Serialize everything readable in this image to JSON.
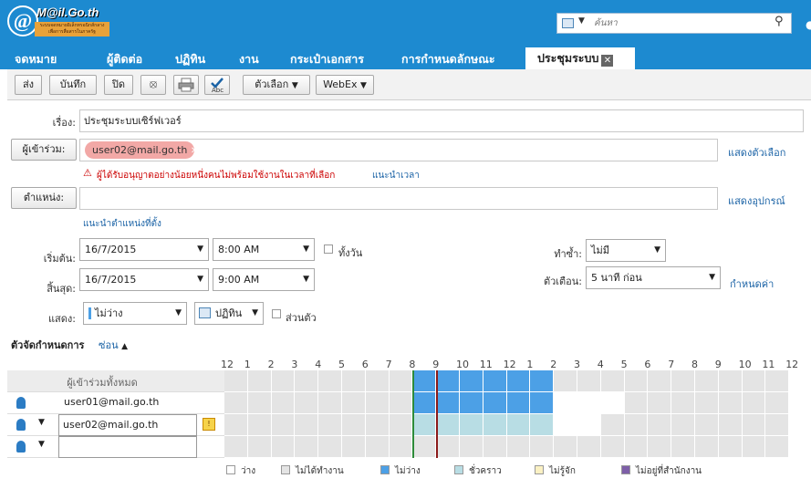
{
  "app": {
    "logo_name": "M@il.Go.th",
    "logo_tagline": "ระบบจดหมายอิเล็กทรอนิกส์กลาง เพื่อการสื่อสารในภาครัฐ",
    "logo_symbol": "@"
  },
  "search": {
    "placeholder": "ค้นหา"
  },
  "colors": {
    "brand": "#1d8ad0",
    "busy": "#4ca0e6",
    "tentative": "#b8dde4",
    "free": "#ffffff",
    "offhours": "#e4e4e4",
    "unknown": "#fbf1c3",
    "away": "#7e5fa8",
    "start_marker": "#2e8b3a",
    "end_marker": "#8b1a1a",
    "error_chip": "#f2a8a6"
  },
  "nav": {
    "items": [
      "จดหมาย",
      "ผู้ติดต่อ",
      "ปฏิทิน",
      "งาน",
      "กระเป๋าเอกสาร",
      "การกำหนดลักษณะ"
    ],
    "active": "ประชุมระบบ",
    "close_icon": "close-icon"
  },
  "toolbar": {
    "send": "ส่ง",
    "save": "บันทึก",
    "close": "ปิด",
    "options": "ตัวเลือก",
    "webex": "WebEx"
  },
  "form": {
    "subject_label": "เรื่อง:",
    "subject_value": "ประชุมระบบเซิร์ฟเวอร์",
    "attendees_label": "ผู้เข้าร่วม:",
    "attendee_chip": "user02@mail.go.th",
    "show_options": "แสดงตัวเลือก",
    "warning_text": "ผู้ได้รับอนุญาตอย่างน้อยหนึ่งคนไม่พร้อมใช้งานในเวลาที่เลือก",
    "suggest_time": "แนะนำเวลา",
    "location_label": "ตำแหน่ง:",
    "show_equipment": "แสดงอุปกรณ์",
    "suggest_location": "แนะนำตำแหน่งที่ตั้ง",
    "start_label": "เริ่มต้น:",
    "start_date": "16/7/2015",
    "start_time": "8:00 AM",
    "allday": "ทั้งวัน",
    "end_label": "สิ้นสุด:",
    "end_date": "16/7/2015",
    "end_time": "9:00 AM",
    "repeat_label": "ทำซ้ำ:",
    "repeat_value": "ไม่มี",
    "reminder_label": "ตัวเตือน:",
    "reminder_value": "5 นาที ก่อน",
    "configure": "กำหนดค่า",
    "show_label": "แสดง:",
    "show_value": "ไม่ว่าง",
    "calendar_value": "ปฏิทิน",
    "private": "ส่วนตัว"
  },
  "scheduler": {
    "title": "ตัวจัดกำหนดการ",
    "hide": "ซ่อน",
    "hours": [
      "12",
      "1",
      "2",
      "3",
      "4",
      "5",
      "6",
      "7",
      "8",
      "9",
      "10",
      "11",
      "12",
      "1",
      "2",
      "3",
      "4",
      "5",
      "6",
      "7",
      "8",
      "9",
      "10",
      "11",
      "12"
    ],
    "all_attendees": "ผู้เข้าร่วมทั้งหมด",
    "rows": [
      {
        "name": "user01@mail.go.th",
        "slots": "OOOOOOOOBBBBBBFFFOOOOOOO"
      },
      {
        "name": "user02@mail.go.th",
        "slots": "OOOOOOOOTTTTTTFFOOOOOOOO"
      },
      {
        "name": "",
        "slots": "OOOOOOOOOOOOOOOOOOOOOOOO"
      }
    ],
    "all_slots": "OOOOOOOOBBBBBBOOOOOOOOOO",
    "meeting_start_hour": 8,
    "meeting_end_hour": 9,
    "legend": [
      {
        "label": "ว่าง",
        "key": "free"
      },
      {
        "label": "ไม่ได้ทำงาน",
        "key": "offhours"
      },
      {
        "label": "ไม่ว่าง",
        "key": "busy"
      },
      {
        "label": "ชั่วคราว",
        "key": "tentative"
      },
      {
        "label": "ไม่รู้จัก",
        "key": "unknown"
      },
      {
        "label": "ไม่อยู่ที่สำนักงาน",
        "key": "away"
      }
    ]
  }
}
